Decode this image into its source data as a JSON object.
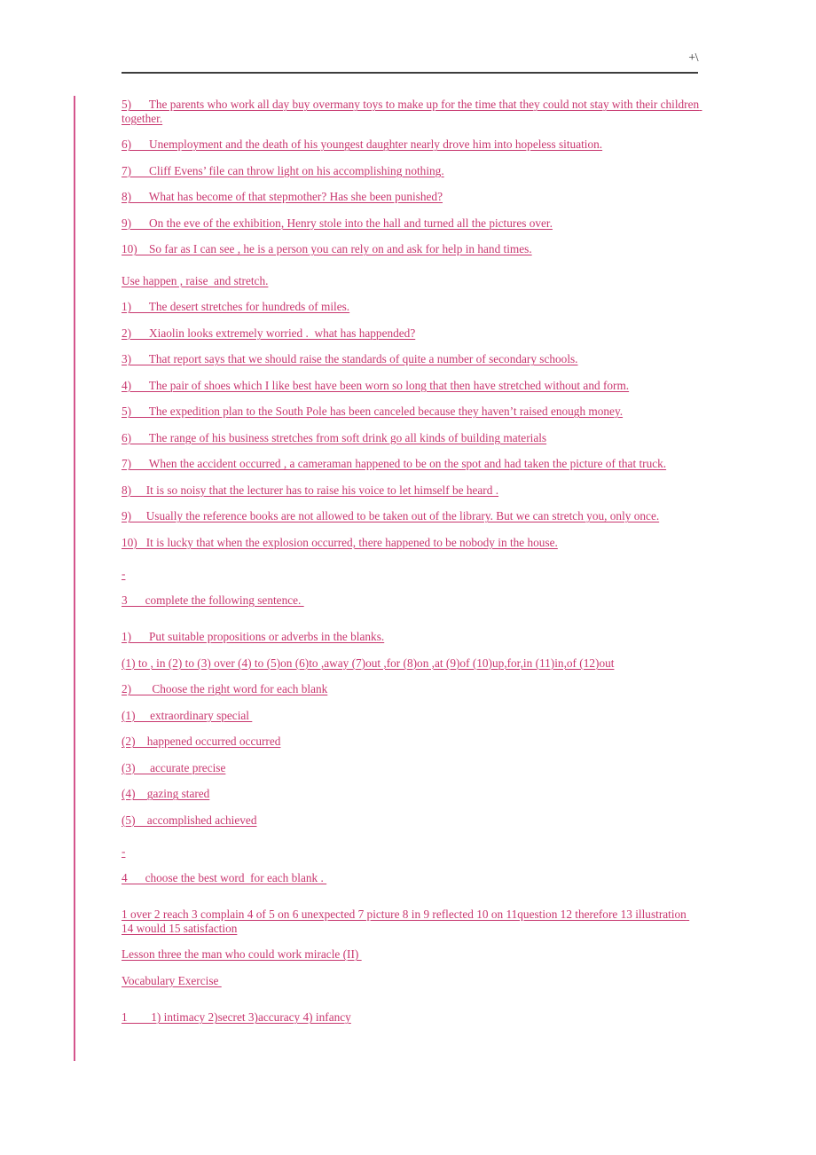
{
  "page": {
    "header_mark": "+\\",
    "accent_color": "#c8366e",
    "rule_color": "#3d3d3d",
    "change_bar_color": "#d4558c",
    "background": "#ffffff"
  },
  "content": {
    "translation_answers": [
      "5)      The parents who work all day buy overmany toys to make up for the time that they could not stay with their children together.",
      "6)      Unemployment and the death of his youngest daughter nearly drove him into hopeless situation.",
      "7)      Cliff Evens’ file can throw light on his accomplishing nothing.",
      "8)      What has become of that stepmother? Has she been punished?",
      "9)      On the eve of the exhibition, Henry stole into the hall and turned all the pictures over.",
      "10)    So far as I can see , he is a person you can rely on and ask for help in hand times."
    ],
    "use_words_heading": "Use happen , raise  and stretch.",
    "use_words_answers": [
      "1)      The desert stretches for hundreds of miles.",
      "2)      Xiaolin looks extremely worried .  what has happended?",
      "3)      That report says that we should raise the standards of quite a number of secondary schools.",
      "4)      The pair of shoes which I like best have been worn so long that then have stretched without and form.",
      "5)      The expedition plan to the South Pole has been canceled because they haven’t raised enough money.",
      "6)      The range of his business stretches from soft drink go all kinds of building materials",
      "7)      When the accident occurred , a cameraman happened to be on the spot and had taken the picture of that truck.",
      "8)     It is so noisy that the lecturer has to raise his voice to let himself be heard .",
      "9)     Usually the reference books are not allowed to be taken out of the library. But we can stretch you, only once.",
      "10)   It is lucky that when the explosion occurred, there happened to be nobody in the house."
    ],
    "spacer_dash_1": "-",
    "section3_heading": "3      complete the following sentence. ",
    "section3_sub1": "1)      Put suitable propositions or adverbs in the blanks.",
    "section3_prepositions": "(1) to , in (2) to (3) over (4) to (5)on (6)to ,away (7)out ,for (8)on ,at (9)of (10)up,for,in (11)in,of (12)out",
    "section3_sub2": "2)       Choose the right word for each blank",
    "section3_word_choices": [
      "(1)     extraordinary special ",
      "(2)    happened occurred occurred",
      "(3)     accurate precise",
      "(4)    gazing stared",
      "(5)    accomplished achieved"
    ],
    "spacer_dash_2": "-",
    "section4_heading": "4      choose the best word  for each blank . ",
    "section4_answers": "1 over 2 reach 3 complain 4 of 5 on 6 unexpected 7 picture 8 in 9 reflected 10 on 11question 12 therefore 13 illustration 14 would 15 satisfaction",
    "lesson_heading": "Lesson three the man who could work miracle (II) ",
    "vocabulary_heading": "Vocabulary Exercise ",
    "vocabulary_answers": "1        1) intimacy 2)secret 3)accuracy 4) infancy"
  }
}
